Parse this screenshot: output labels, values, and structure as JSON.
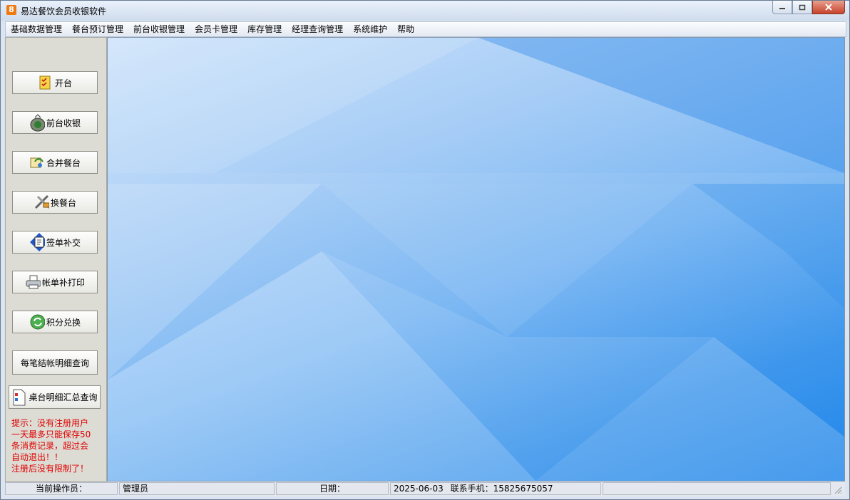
{
  "window": {
    "title": "易达餐饮会员收银软件",
    "app_icon_glyph": "8",
    "controls": [
      "minimize",
      "restore",
      "close"
    ]
  },
  "menu": [
    {
      "label": "基础数据管理"
    },
    {
      "label": "餐台预订管理"
    },
    {
      "label": "前台收银管理"
    },
    {
      "label": "会员卡管理"
    },
    {
      "label": "库存管理"
    },
    {
      "label": "经理查询管理"
    },
    {
      "label": "系统维护"
    },
    {
      "label": "帮助"
    }
  ],
  "sidebar": {
    "buttons": [
      {
        "label": "开台",
        "icon": "checklist-icon"
      },
      {
        "label": "前台收银",
        "icon": "money-bag-icon"
      },
      {
        "label": "合并餐台",
        "icon": "merge-icon"
      },
      {
        "label": "换餐台",
        "icon": "tools-icon"
      },
      {
        "label": "签单补交",
        "icon": "book-icon"
      },
      {
        "label": "帐单补打印",
        "icon": "printer-icon"
      },
      {
        "label": "积分兑换",
        "icon": "exchange-icon"
      },
      {
        "label": "每笔结帐明细查询",
        "icon": ""
      },
      {
        "label": "桌台明细汇总查询",
        "icon": "document-icon"
      }
    ],
    "notice_lines": [
      "提示：没有注册用户",
      "一天最多只能保存50",
      "条消费记录，超过会",
      "自动退出！！",
      "注册后没有限制了！"
    ],
    "notice_color": "#e00000"
  },
  "status": {
    "operator_label": "当前操作员：",
    "operator_value": "管理员",
    "date_label": "日期：",
    "date_value": "2025-06-03",
    "phone_text": "联系手机：15825675057"
  }
}
